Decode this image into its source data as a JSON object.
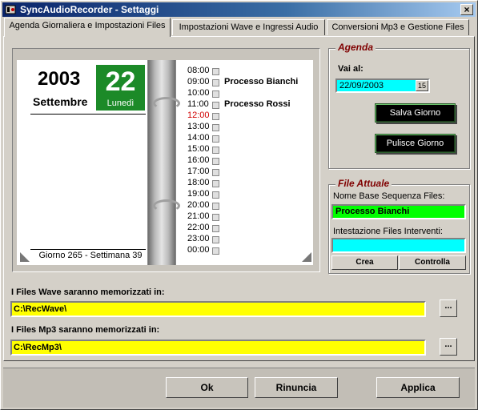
{
  "window": {
    "title": "SyncAudioRecorder - Settaggi",
    "close_label": "×"
  },
  "tabs": [
    {
      "label": "Agenda Giornaliera e Impostazioni Files",
      "active": true
    },
    {
      "label": "Impostazioni Wave e Ingressi Audio",
      "active": false
    },
    {
      "label": "Conversioni Mp3 e Gestione Files",
      "active": false
    }
  ],
  "planner": {
    "year": "2003",
    "month": "Settembre",
    "day_number": "22",
    "day_name": "Lunedì",
    "day_info": "Giorno 265 - Settimana 39",
    "hours": [
      {
        "time": "08:00",
        "event": ""
      },
      {
        "time": "09:00",
        "event": "Processo Bianchi"
      },
      {
        "time": "10:00",
        "event": ""
      },
      {
        "time": "11:00",
        "event": "Processo Rossi"
      },
      {
        "time": "12:00",
        "event": "",
        "current": true
      },
      {
        "time": "13:00",
        "event": ""
      },
      {
        "time": "14:00",
        "event": ""
      },
      {
        "time": "15:00",
        "event": ""
      },
      {
        "time": "16:00",
        "event": ""
      },
      {
        "time": "17:00",
        "event": ""
      },
      {
        "time": "18:00",
        "event": ""
      },
      {
        "time": "19:00",
        "event": ""
      },
      {
        "time": "20:00",
        "event": ""
      },
      {
        "time": "21:00",
        "event": ""
      },
      {
        "time": "22:00",
        "event": ""
      },
      {
        "time": "23:00",
        "event": ""
      },
      {
        "time": "00:00",
        "event": ""
      }
    ]
  },
  "agenda": {
    "title": "Agenda",
    "goto_label": "Vai al:",
    "date_value": "22/09/2003",
    "date_button_label": "15",
    "save_day_label": "Salva Giorno",
    "clear_day_label": "Pulisce Giorno"
  },
  "current_file": {
    "title": "File Attuale",
    "sequence_base_label": "Nome Base Sequenza Files:",
    "sequence_base_value": "Processo Bianchi",
    "sequence_base_color": "#00ff00",
    "interventions_label": "Intestazione Files Interventi:",
    "interventions_value": "",
    "interventions_color": "#00ffff",
    "create_label": "Crea",
    "check_label": "Controlla"
  },
  "paths": {
    "wave_label": "I Files Wave saranno memorizzati in:",
    "wave_value": "C:\\RecWave\\",
    "mp3_label": "I Files Mp3 saranno memorizzati in:",
    "mp3_value": "C:\\RecMp3\\",
    "browse_label": "...",
    "field_color": "#ffff00"
  },
  "footer": {
    "ok_label": "Ok",
    "cancel_label": "Rinuncia",
    "apply_label": "Applica"
  }
}
